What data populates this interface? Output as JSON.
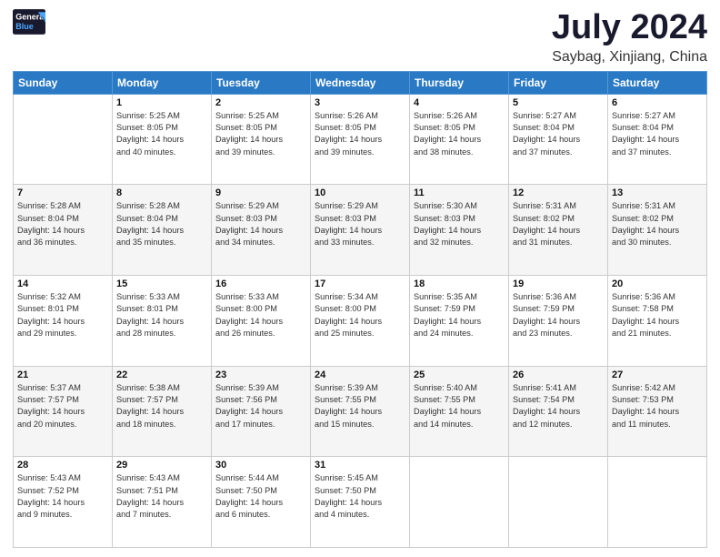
{
  "logo": {
    "line1": "General",
    "line2": "Blue"
  },
  "title": "July 2024",
  "subtitle": "Saybag, Xinjiang, China",
  "days_of_week": [
    "Sunday",
    "Monday",
    "Tuesday",
    "Wednesday",
    "Thursday",
    "Friday",
    "Saturday"
  ],
  "weeks": [
    [
      {
        "day": "",
        "info": ""
      },
      {
        "day": "1",
        "info": "Sunrise: 5:25 AM\nSunset: 8:05 PM\nDaylight: 14 hours\nand 40 minutes."
      },
      {
        "day": "2",
        "info": "Sunrise: 5:25 AM\nSunset: 8:05 PM\nDaylight: 14 hours\nand 39 minutes."
      },
      {
        "day": "3",
        "info": "Sunrise: 5:26 AM\nSunset: 8:05 PM\nDaylight: 14 hours\nand 39 minutes."
      },
      {
        "day": "4",
        "info": "Sunrise: 5:26 AM\nSunset: 8:05 PM\nDaylight: 14 hours\nand 38 minutes."
      },
      {
        "day": "5",
        "info": "Sunrise: 5:27 AM\nSunset: 8:04 PM\nDaylight: 14 hours\nand 37 minutes."
      },
      {
        "day": "6",
        "info": "Sunrise: 5:27 AM\nSunset: 8:04 PM\nDaylight: 14 hours\nand 37 minutes."
      }
    ],
    [
      {
        "day": "7",
        "info": "Sunrise: 5:28 AM\nSunset: 8:04 PM\nDaylight: 14 hours\nand 36 minutes."
      },
      {
        "day": "8",
        "info": "Sunrise: 5:28 AM\nSunset: 8:04 PM\nDaylight: 14 hours\nand 35 minutes."
      },
      {
        "day": "9",
        "info": "Sunrise: 5:29 AM\nSunset: 8:03 PM\nDaylight: 14 hours\nand 34 minutes."
      },
      {
        "day": "10",
        "info": "Sunrise: 5:29 AM\nSunset: 8:03 PM\nDaylight: 14 hours\nand 33 minutes."
      },
      {
        "day": "11",
        "info": "Sunrise: 5:30 AM\nSunset: 8:03 PM\nDaylight: 14 hours\nand 32 minutes."
      },
      {
        "day": "12",
        "info": "Sunrise: 5:31 AM\nSunset: 8:02 PM\nDaylight: 14 hours\nand 31 minutes."
      },
      {
        "day": "13",
        "info": "Sunrise: 5:31 AM\nSunset: 8:02 PM\nDaylight: 14 hours\nand 30 minutes."
      }
    ],
    [
      {
        "day": "14",
        "info": "Sunrise: 5:32 AM\nSunset: 8:01 PM\nDaylight: 14 hours\nand 29 minutes."
      },
      {
        "day": "15",
        "info": "Sunrise: 5:33 AM\nSunset: 8:01 PM\nDaylight: 14 hours\nand 28 minutes."
      },
      {
        "day": "16",
        "info": "Sunrise: 5:33 AM\nSunset: 8:00 PM\nDaylight: 14 hours\nand 26 minutes."
      },
      {
        "day": "17",
        "info": "Sunrise: 5:34 AM\nSunset: 8:00 PM\nDaylight: 14 hours\nand 25 minutes."
      },
      {
        "day": "18",
        "info": "Sunrise: 5:35 AM\nSunset: 7:59 PM\nDaylight: 14 hours\nand 24 minutes."
      },
      {
        "day": "19",
        "info": "Sunrise: 5:36 AM\nSunset: 7:59 PM\nDaylight: 14 hours\nand 23 minutes."
      },
      {
        "day": "20",
        "info": "Sunrise: 5:36 AM\nSunset: 7:58 PM\nDaylight: 14 hours\nand 21 minutes."
      }
    ],
    [
      {
        "day": "21",
        "info": "Sunrise: 5:37 AM\nSunset: 7:57 PM\nDaylight: 14 hours\nand 20 minutes."
      },
      {
        "day": "22",
        "info": "Sunrise: 5:38 AM\nSunset: 7:57 PM\nDaylight: 14 hours\nand 18 minutes."
      },
      {
        "day": "23",
        "info": "Sunrise: 5:39 AM\nSunset: 7:56 PM\nDaylight: 14 hours\nand 17 minutes."
      },
      {
        "day": "24",
        "info": "Sunrise: 5:39 AM\nSunset: 7:55 PM\nDaylight: 14 hours\nand 15 minutes."
      },
      {
        "day": "25",
        "info": "Sunrise: 5:40 AM\nSunset: 7:55 PM\nDaylight: 14 hours\nand 14 minutes."
      },
      {
        "day": "26",
        "info": "Sunrise: 5:41 AM\nSunset: 7:54 PM\nDaylight: 14 hours\nand 12 minutes."
      },
      {
        "day": "27",
        "info": "Sunrise: 5:42 AM\nSunset: 7:53 PM\nDaylight: 14 hours\nand 11 minutes."
      }
    ],
    [
      {
        "day": "28",
        "info": "Sunrise: 5:43 AM\nSunset: 7:52 PM\nDaylight: 14 hours\nand 9 minutes."
      },
      {
        "day": "29",
        "info": "Sunrise: 5:43 AM\nSunset: 7:51 PM\nDaylight: 14 hours\nand 7 minutes."
      },
      {
        "day": "30",
        "info": "Sunrise: 5:44 AM\nSunset: 7:50 PM\nDaylight: 14 hours\nand 6 minutes."
      },
      {
        "day": "31",
        "info": "Sunrise: 5:45 AM\nSunset: 7:50 PM\nDaylight: 14 hours\nand 4 minutes."
      },
      {
        "day": "",
        "info": ""
      },
      {
        "day": "",
        "info": ""
      },
      {
        "day": "",
        "info": ""
      }
    ]
  ]
}
